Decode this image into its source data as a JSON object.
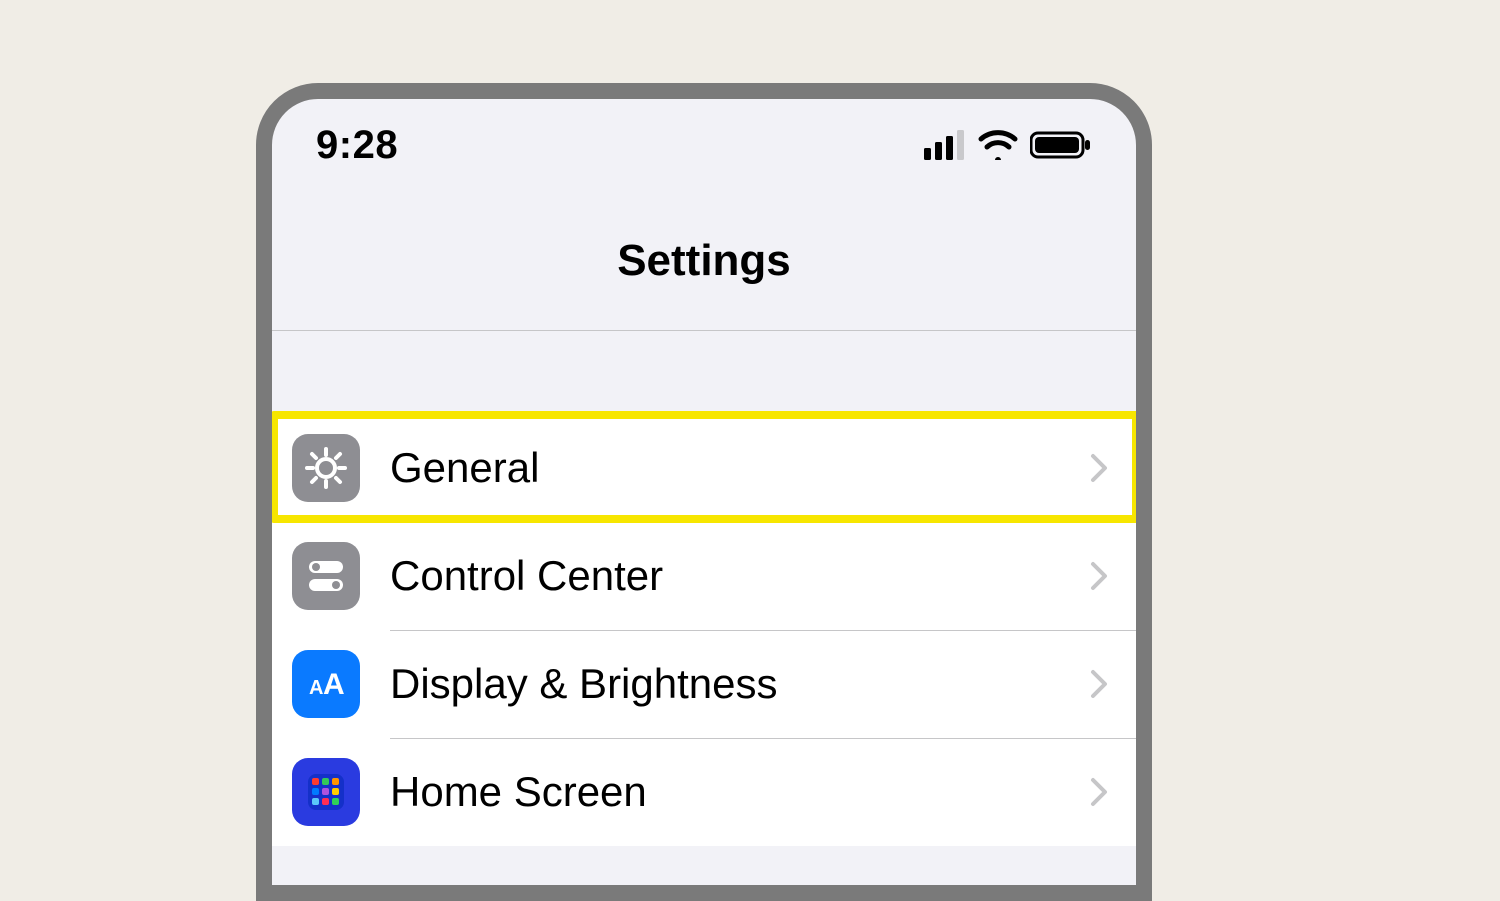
{
  "status": {
    "time": "9:28"
  },
  "nav": {
    "title": "Settings"
  },
  "rows": {
    "general": {
      "label": "General"
    },
    "control": {
      "label": "Control Center"
    },
    "display": {
      "label": "Display & Brightness"
    },
    "home": {
      "label": "Home Screen"
    }
  }
}
